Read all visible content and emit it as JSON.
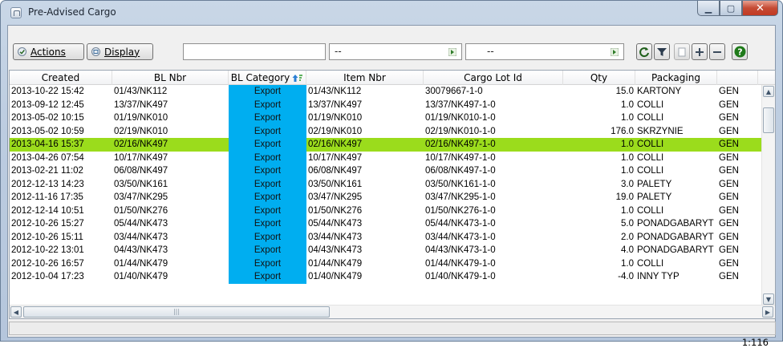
{
  "window": {
    "title": "Pre-Advised Cargo"
  },
  "toolbar": {
    "actions_label": "Actions",
    "display_label": "Display",
    "search_value": "",
    "filter1_value": "--",
    "filter2_value": "--"
  },
  "grid": {
    "columns": [
      "Created",
      "BL Nbr",
      "BL Category",
      "Item Nbr",
      "Cargo Lot Id",
      "Qty",
      "Packaging",
      ""
    ],
    "rows": [
      [
        "2013-10-22 15:42",
        "01/43/NK112",
        "Export",
        "01/43/NK112",
        "30079667-1-0",
        "15.0",
        "KARTONY",
        "GEN"
      ],
      [
        "2013-09-12 12:45",
        "13/37/NK497",
        "Export",
        "13/37/NK497",
        "13/37/NK497-1-0",
        "1.0",
        "COLLI",
        "GEN"
      ],
      [
        "2013-05-02 10:15",
        "01/19/NK010",
        "Export",
        "01/19/NK010",
        "01/19/NK010-1-0",
        "1.0",
        "COLLI",
        "GEN"
      ],
      [
        "2013-05-02 10:59",
        "02/19/NK010",
        "Export",
        "02/19/NK010",
        "02/19/NK010-1-0",
        "176.0",
        "SKRZYNIE",
        "GEN"
      ],
      [
        "2013-04-16 15:37",
        "02/16/NK497",
        "Export",
        "02/16/NK497",
        "02/16/NK497-1-0",
        "1.0",
        "COLLI",
        "GEN"
      ],
      [
        "2013-04-26 07:54",
        "10/17/NK497",
        "Export",
        "10/17/NK497",
        "10/17/NK497-1-0",
        "1.0",
        "COLLI",
        "GEN"
      ],
      [
        "2013-02-21 11:02",
        "06/08/NK497",
        "Export",
        "06/08/NK497",
        "06/08/NK497-1-0",
        "1.0",
        "COLLI",
        "GEN"
      ],
      [
        "2012-12-13 14:23",
        "03/50/NK161",
        "Export",
        "03/50/NK161",
        "03/50/NK161-1-0",
        "3.0",
        "PALETY",
        "GEN"
      ],
      [
        "2012-11-16 17:35",
        "03/47/NK295",
        "Export",
        "03/47/NK295",
        "03/47/NK295-1-0",
        "19.0",
        "PALETY",
        "GEN"
      ],
      [
        "2012-12-14 10:51",
        "01/50/NK276",
        "Export",
        "01/50/NK276",
        "01/50/NK276-1-0",
        "1.0",
        "COLLI",
        "GEN"
      ],
      [
        "2012-10-26 15:27",
        "05/44/NK473",
        "Export",
        "05/44/NK473",
        "05/44/NK473-1-0",
        "5.0",
        "PONADGABARYT",
        "GEN"
      ],
      [
        "2012-10-26 15:11",
        "03/44/NK473",
        "Export",
        "03/44/NK473",
        "03/44/NK473-1-0",
        "2.0",
        "PONADGABARYT",
        "GEN"
      ],
      [
        "2012-10-22 13:01",
        "04/43/NK473",
        "Export",
        "04/43/NK473",
        "04/43/NK473-1-0",
        "4.0",
        "PONADGABARYT",
        "GEN"
      ],
      [
        "2012-10-26 16:57",
        "01/44/NK479",
        "Export",
        "01/44/NK479",
        "01/44/NK479-1-0",
        "1.0",
        "COLLI",
        "GEN"
      ],
      [
        "2012-10-04 17:23",
        "01/40/NK479",
        "Export",
        "01/40/NK479",
        "01/40/NK479-1-0",
        "-4.0",
        "INNY TYP",
        "GEN"
      ]
    ],
    "selected_index": 4
  },
  "status": {
    "pager": "1:116"
  },
  "colors": {
    "category_cell": "#00aef0",
    "selected_row": "#9bdc1c"
  },
  "icons": [
    "window-icon",
    "check-icon",
    "display-icon",
    "dropdown-arrow-icon",
    "refresh-icon",
    "filter-icon",
    "copy-icon",
    "add-icon",
    "remove-icon",
    "help-icon",
    "sort-asc-icon"
  ]
}
